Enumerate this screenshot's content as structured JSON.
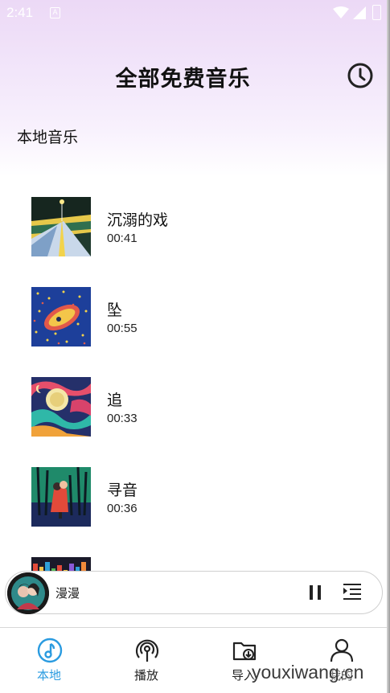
{
  "status_bar": {
    "time": "2:41",
    "notification_glyph": "A"
  },
  "header": {
    "title": "全部免费音乐",
    "history_icon": "clock-history-icon"
  },
  "section": {
    "title": "本地音乐"
  },
  "songs": [
    {
      "title": "沉溺的戏",
      "duration": "00:41"
    },
    {
      "title": "坠",
      "duration": "00:55"
    },
    {
      "title": "追",
      "duration": "00:33"
    },
    {
      "title": "寻音",
      "duration": "00:36"
    },
    {
      "title": "",
      "duration": ""
    }
  ],
  "player": {
    "title": "漫漫",
    "pause_icon": "pause-icon",
    "playlist_icon": "playlist-icon"
  },
  "nav": {
    "items": [
      {
        "label": "本地",
        "icon": "music-note-icon",
        "active": true
      },
      {
        "label": "播放",
        "icon": "broadcast-icon",
        "active": false
      },
      {
        "label": "导入",
        "icon": "folder-import-icon",
        "active": false
      },
      {
        "label": "我的",
        "icon": "user-icon",
        "active": false
      }
    ]
  },
  "watermark": "youxiwang.cn",
  "colors": {
    "accent": "#2a9be0",
    "header_gradient_top": "#ecd9f6",
    "text": "#111111"
  }
}
